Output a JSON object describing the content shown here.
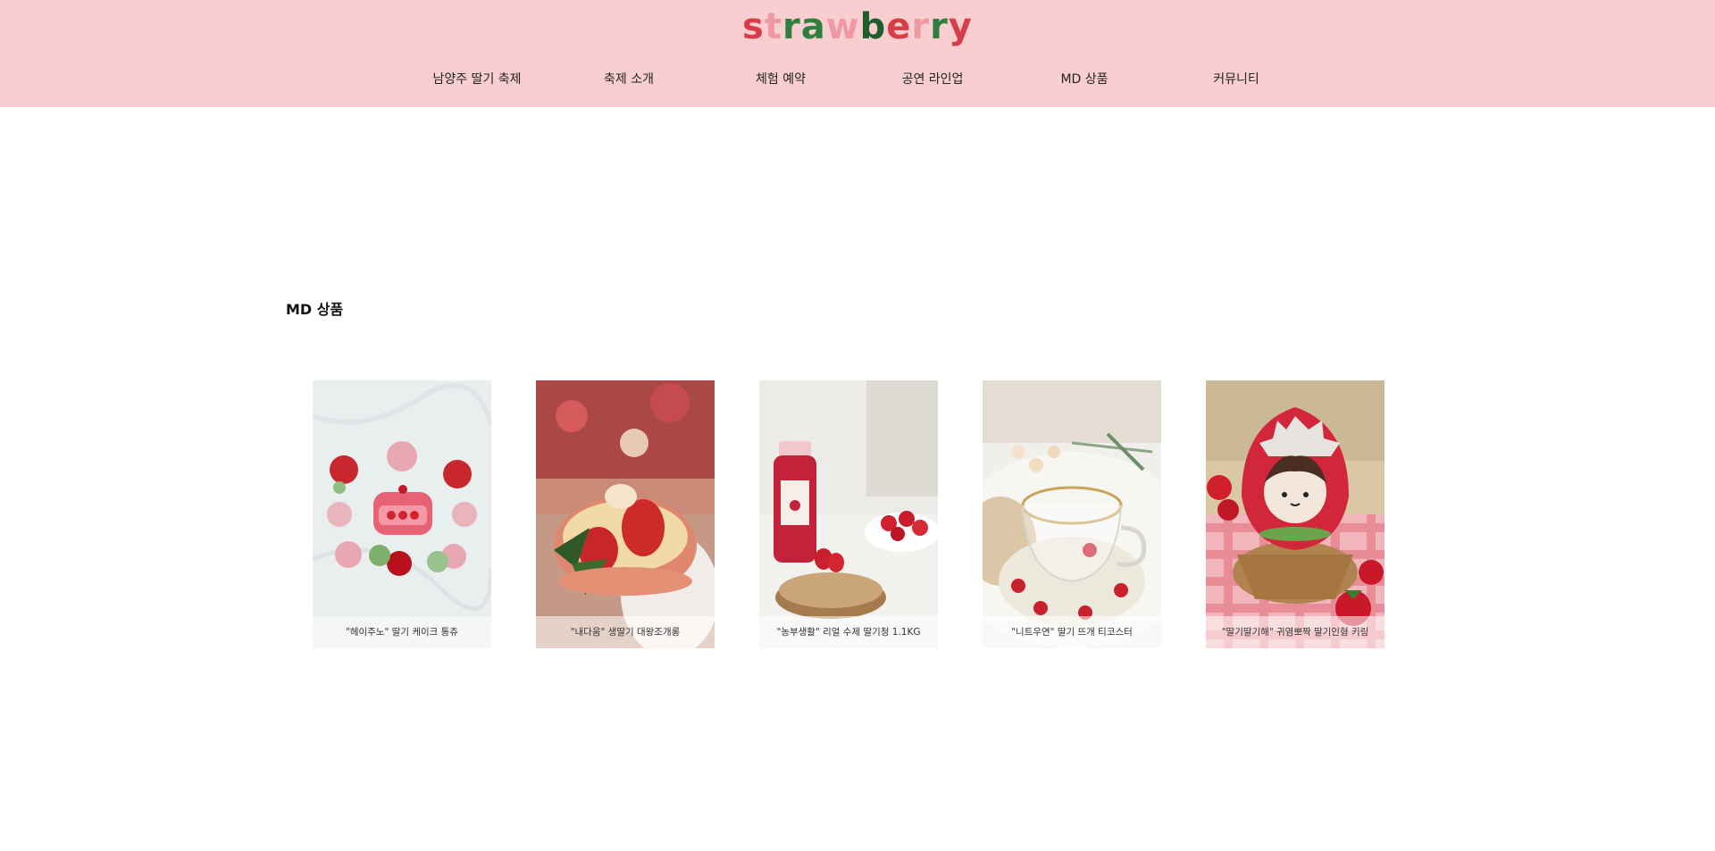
{
  "header": {
    "logo_letters": [
      {
        "char": "s",
        "color": "#d63d48"
      },
      {
        "char": "t",
        "color": "#ef9aa2"
      },
      {
        "char": "r",
        "color": "#2f7f3f"
      },
      {
        "char": "a",
        "color": "#2f7f3f"
      },
      {
        "char": "w",
        "color": "#ef9aa2"
      },
      {
        "char": "b",
        "color": "#1f5e2c"
      },
      {
        "char": "e",
        "color": "#d63d48"
      },
      {
        "char": "r",
        "color": "#ef9aa2"
      },
      {
        "char": "r",
        "color": "#2f7f3f"
      },
      {
        "char": "y",
        "color": "#d63d48"
      }
    ],
    "nav": [
      "남양주 딸기 축제",
      "축제 소개",
      "체험 예약",
      "공연 라인업",
      "MD 상품",
      "커뮤니티"
    ]
  },
  "section": {
    "title": "MD 상품"
  },
  "products": [
    {
      "caption": "\"헤이주노\" 딸기 케이크 통츄",
      "icon": "crochet-strawberry-keyring-image"
    },
    {
      "caption": "\"내다움\" 생딸기 대왕조개롱",
      "icon": "strawberry-macaron-image"
    },
    {
      "caption": "\"농부생활\" 리얼 수제 딸기청 1.1KG",
      "icon": "strawberry-syrup-bottle-image"
    },
    {
      "caption": "\"니트우연\" 딸기 뜨개 티코스터",
      "icon": "knit-coaster-glass-cup-image"
    },
    {
      "caption": "\"딸기딸기해\" 귀염뽀짝 딸기인형 키링",
      "icon": "strawberry-doll-basket-image"
    }
  ],
  "colors": {
    "header_bg": "#f9ced0"
  }
}
